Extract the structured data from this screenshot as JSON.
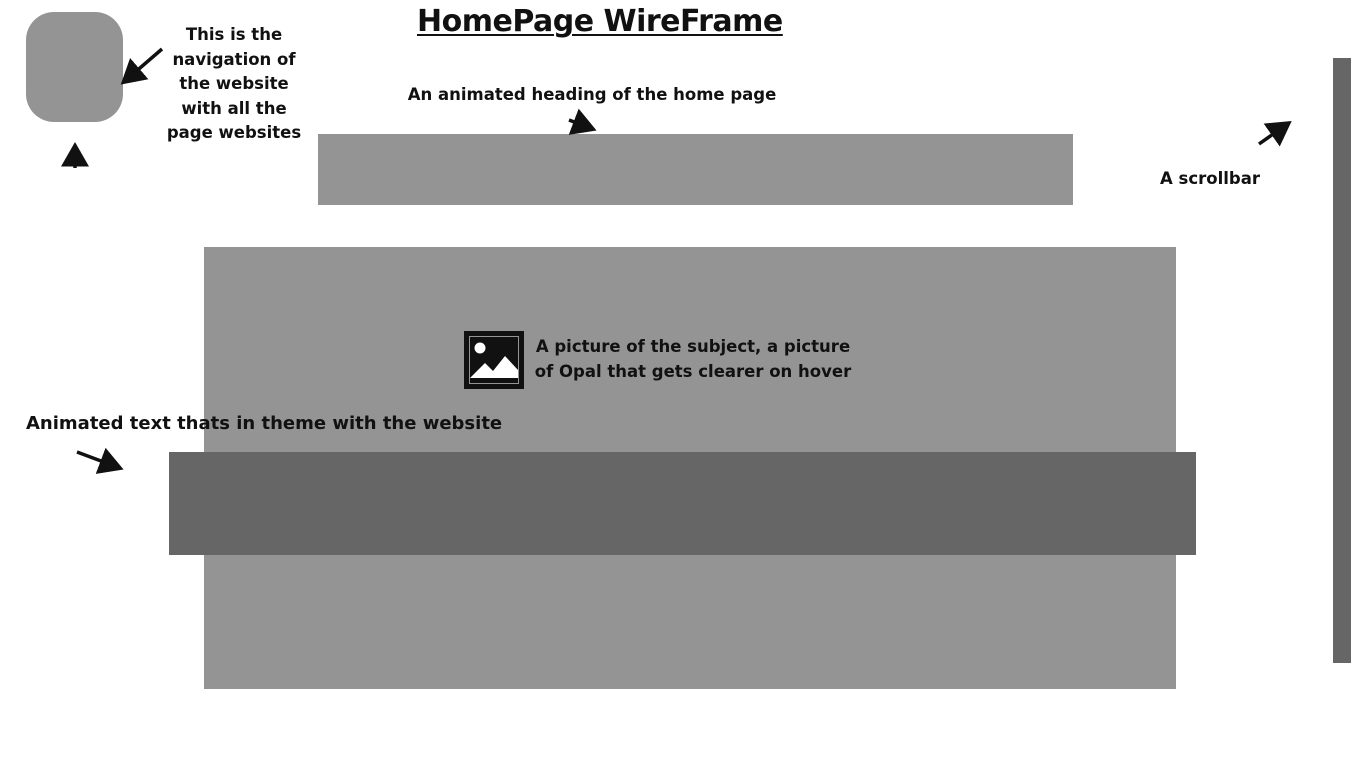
{
  "diagram": {
    "title": "HomePage WireFrame",
    "annotations": {
      "navigation": "This is the navigation of the website with all the page websites",
      "heading": "An animated heading of the home page",
      "scrollbar": "A scrollbar",
      "picture": "A picture of the subject, a picture of Opal that gets clearer on hover",
      "animated_text": "Animated text thats in theme with the website"
    },
    "icons": {
      "image_placeholder": "image-icon",
      "arrows": "arrow-icon"
    },
    "colors": {
      "placeholder_light": "#949494",
      "placeholder_dark": "#666666",
      "text": "#111111",
      "background": "#ffffff"
    }
  }
}
